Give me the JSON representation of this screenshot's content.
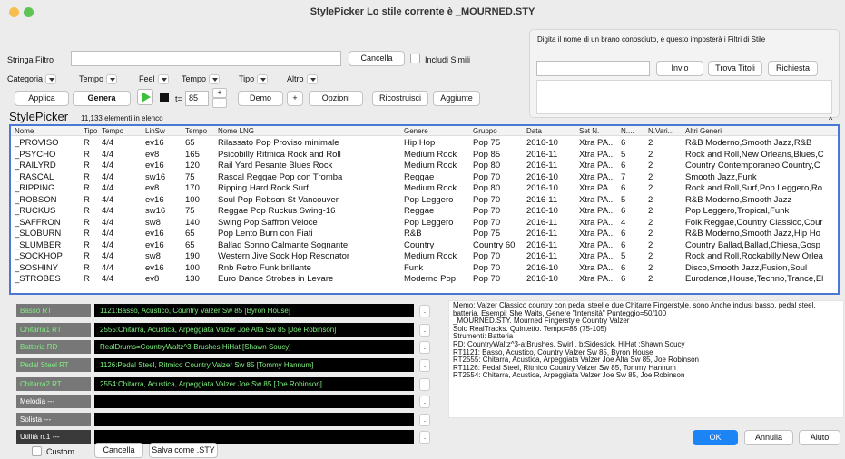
{
  "window": {
    "title": "StylePicker    Lo stile corrente è _MOURNED.STY"
  },
  "filter": {
    "label": "Stringa Filtro",
    "value": "",
    "cancel_label": "Cancella",
    "include_similar_label": "Includi Simili"
  },
  "right_panel": {
    "hint": "Digita il nome di un brano conosciuto, e questo imposterà i Filtri di Stile",
    "song_input_value": "",
    "send_label": "Invio",
    "find_titles_label": "Trova Titoli",
    "request_label": "Richiesta"
  },
  "filters_row": {
    "category_label": "Categoria",
    "tempo_label": "Tempo",
    "feel_label": "Feel",
    "tempo2_label": "Tempo",
    "type_label": "Tipo",
    "other_label": "Altro"
  },
  "toolbar": {
    "apply_label": "Applica",
    "generate_label": "Genera",
    "tempo_prefix": "t=",
    "tempo_value": "85",
    "plus": "+",
    "minus": "-",
    "demo_label": "Demo",
    "options_label": "Opzioni",
    "rebuild_label": "Ricostruisci",
    "added_label": "Aggiunte"
  },
  "list_header": {
    "title": "StylePicker",
    "count": "11,133 elementi in elenco",
    "collapse": "^"
  },
  "table": {
    "columns": [
      "Nome",
      "Tipo",
      "Tempo",
      "LinSw",
      "Tempo",
      "Nome LNG",
      "Genere",
      "Gruppo",
      "Data",
      "Set N.",
      "N....",
      "N.Vari...",
      "Altri Generi"
    ],
    "rows": [
      [
        "_PROVISO",
        "R",
        "4/4",
        "ev16",
        "65",
        "Rilassato Pop Proviso minimale",
        "Hip Hop",
        "Pop 75",
        "2016-10",
        "Xtra PA...",
        "6",
        "2",
        "R&B Moderno,Smooth Jazz,R&B"
      ],
      [
        "_PSYCHO",
        "R",
        "4/4",
        "ev8",
        "165",
        "Psicobilly Ritmica Rock and Roll",
        "Medium Rock",
        "Pop 85",
        "2016-11",
        "Xtra PA...",
        "5",
        "2",
        "Rock and Roll,New Orleans,Blues,C"
      ],
      [
        "_RAILYRD",
        "R",
        "4/4",
        "ev16",
        "120",
        "Rail Yard Pesante Blues Rock",
        "Medium Rock",
        "Pop 80",
        "2016-11",
        "Xtra PA...",
        "6",
        "2",
        "Country Contemporaneo,Country,C"
      ],
      [
        "_RASCAL",
        "R",
        "4/4",
        "sw16",
        "75",
        "Rascal Reggae Pop con Tromba",
        "Reggae",
        "Pop 70",
        "2016-10",
        "Xtra PA...",
        "7",
        "2",
        "Smooth Jazz,Funk"
      ],
      [
        "_RIPPING",
        "R",
        "4/4",
        "ev8",
        "170",
        "Ripping Hard Rock Surf",
        "Medium Rock",
        "Pop 80",
        "2016-10",
        "Xtra PA...",
        "6",
        "2",
        "Rock and Roll,Surf,Pop Leggero,Ro"
      ],
      [
        "_ROBSON",
        "R",
        "4/4",
        "ev16",
        "100",
        "Soul Pop Robson St Vancouver",
        "Pop Leggero",
        "Pop 70",
        "2016-11",
        "Xtra PA...",
        "5",
        "2",
        "R&B Moderno,Smooth Jazz"
      ],
      [
        "_RUCKUS",
        "R",
        "4/4",
        "sw16",
        "75",
        "Reggae Pop Ruckus Swing-16",
        "Reggae",
        "Pop 70",
        "2016-10",
        "Xtra PA...",
        "6",
        "2",
        "Pop Leggero,Tropical,Funk"
      ],
      [
        "_SAFFRON",
        "R",
        "4/4",
        "sw8",
        "140",
        "Swing Pop Saffron Veloce",
        "Pop Leggero",
        "Pop 70",
        "2016-11",
        "Xtra PA...",
        "4",
        "2",
        "Folk,Reggae,Country Classico,Cour"
      ],
      [
        "_SLOBURN",
        "R",
        "4/4",
        "ev16",
        "65",
        "Pop Lento Burn con Fiati",
        "R&B",
        "Pop 75",
        "2016-11",
        "Xtra PA...",
        "6",
        "2",
        "R&B Moderno,Smooth Jazz,Hip Ho"
      ],
      [
        "_SLUMBER",
        "R",
        "4/4",
        "ev16",
        "65",
        "Ballad Sonno Calmante Sognante",
        "Country",
        "Country 60",
        "2016-11",
        "Xtra PA...",
        "6",
        "2",
        "Country Ballad,Ballad,Chiesa,Gosp"
      ],
      [
        "_SOCKHOP",
        "R",
        "4/4",
        "sw8",
        "190",
        "Western Jive Sock Hop Resonator",
        "Medium Rock",
        "Pop 70",
        "2016-11",
        "Xtra PA...",
        "5",
        "2",
        "Rock and Roll,Rockabilly,New Orlea"
      ],
      [
        "_SOSHINY",
        "R",
        "4/4",
        "ev16",
        "100",
        "Rnb Retro Funk brillante",
        "Funk",
        "Pop 70",
        "2016-10",
        "Xtra PA...",
        "6",
        "2",
        "Disco,Smooth Jazz,Fusion,Soul"
      ],
      [
        "_STROBES",
        "R",
        "4/4",
        "ev8",
        "130",
        "Euro Dance Strobes in Levare",
        "Moderno Pop",
        "Pop 70",
        "2016-10",
        "Xtra PA...",
        "6",
        "2",
        "Eurodance,House,Techno,Trance,El"
      ]
    ]
  },
  "tracks": [
    {
      "label": "Basso RT",
      "value": "1121:Basso, Acustico, Country Valzer Sw 85 [Byron House]",
      "btn": "."
    },
    {
      "label": "Chitarra1 RT",
      "value": "2555:Chitarra, Acustica, Arpeggiata Valzer Joe Alta Sw 85 [Joe Robinson]",
      "btn": "."
    },
    {
      "label": "Batteria RD",
      "value": "RealDrums=CountryWaltz^3-Brushes,HiHat [Shawn Soucy]",
      "btn": "."
    },
    {
      "label": "Pedal Steel RT",
      "value": "1126:Pedal Steel, Ritmico Country Valzer Sw 85 [Tommy Hannum]",
      "btn": "."
    },
    {
      "label": "Chitarra2 RT",
      "value": "2554:Chitarra, Acustica, Arpeggiata Valzer Joe Sw 85 [Joe Robinson]",
      "btn": "."
    },
    {
      "label": "Melodia ---",
      "value": "",
      "btn": "."
    },
    {
      "label": "Solista ---",
      "value": "",
      "btn": "."
    },
    {
      "label": "Utilità n.1 ---",
      "value": "",
      "btn": "."
    }
  ],
  "bottom_left": {
    "custom_label": "Custom",
    "cancel_label": "Cancella",
    "save_label": "Salva come .STY"
  },
  "memo": {
    "lines": [
      "Memo: Valzer Classico country con pedal steel e due Chitarre Fingerstyle. sono Anche inclusi basso, pedal steel,",
      "batteria. Esempi: She Waits, Genere \"Intensità\" Punteggio=50/100",
      "_MOURNED.STY. Mourned Fingerstyle Country Valzer",
      "Solo RealTracks. Quintetto. Tempo=85 (75-105)",
      "Strumenti: Batteria",
      "RD: CountryWaltz^3-a:Brushes, Swirl , b:Sidestick, HiHat  :Shawn Soucy",
      "RT1121: Basso, Acustico, Country Valzer Sw 85, Byron House",
      "RT2555: Chitarra, Acustica, Arpeggiata Valzer Joe Alta Sw 85, Joe Robinson",
      "RT1126: Pedal Steel, Ritmico Country Valzer Sw 85, Tommy Hannum",
      "RT2554: Chitarra, Acustica, Arpeggiata Valzer Joe Sw 85, Joe Robinson"
    ]
  },
  "dialog": {
    "ok_label": "OK",
    "cancel_label": "Annulla",
    "help_label": "Aiuto"
  },
  "colors": {
    "accent": "#1d84f5",
    "table_border": "#4a78d4",
    "track_text": "#7ef07e",
    "play_green": "#3cc03c"
  }
}
